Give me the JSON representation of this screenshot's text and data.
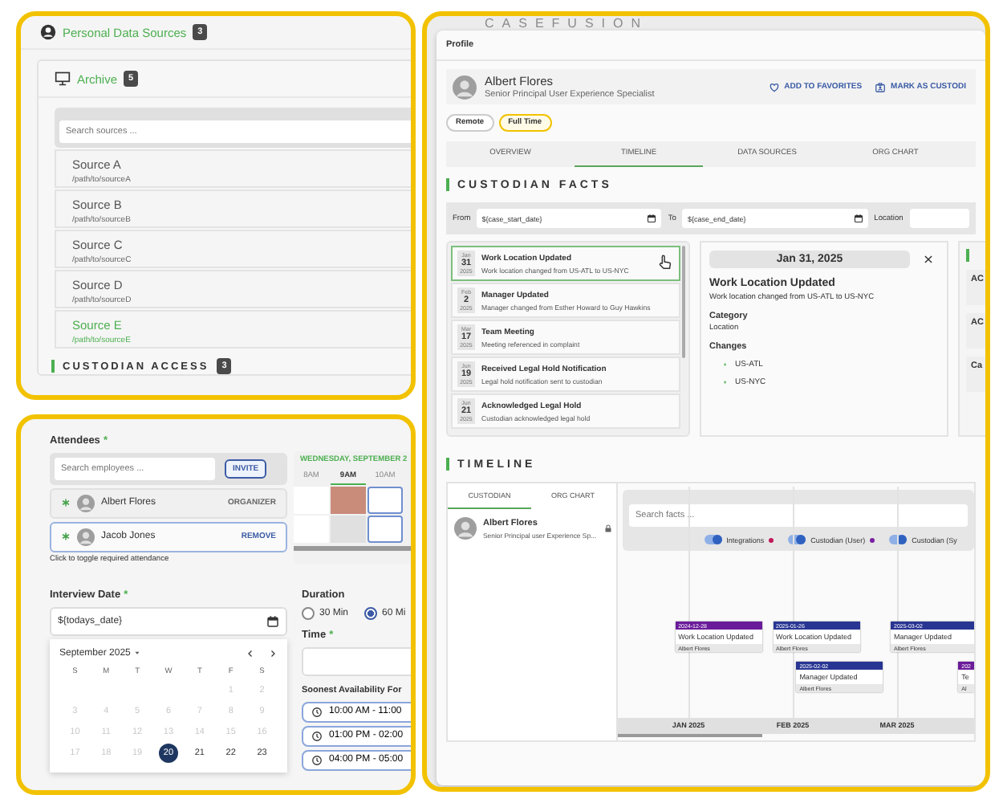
{
  "panel_sources": {
    "title": "Personal Data Sources",
    "count": "3",
    "archive": {
      "title": "Archive",
      "count": "5",
      "search_placeholder": "Search sources ...",
      "sources": [
        {
          "name": "Source A",
          "path": "/path/to/sourceA",
          "selected": false
        },
        {
          "name": "Source B",
          "path": "/path/to/sourceB",
          "selected": false
        },
        {
          "name": "Source C",
          "path": "/path/to/sourceC",
          "selected": false
        },
        {
          "name": "Source D",
          "path": "/path/to/sourceD",
          "selected": false
        },
        {
          "name": "Source E",
          "path": "/path/to/sourceE",
          "selected": true
        }
      ]
    },
    "custodian_access": {
      "title": "CUSTODIAN ACCESS",
      "count": "3"
    }
  },
  "panel_meeting": {
    "attendees": {
      "label": "Attendees",
      "required_mark": "*",
      "search_placeholder": "Search employees ...",
      "invite": "INVITE",
      "people": [
        {
          "name": "Albert Flores",
          "action": "ORGANIZER",
          "required": true,
          "selected": false
        },
        {
          "name": "Jacob Jones",
          "action": "REMOVE",
          "required": true,
          "selected": true
        }
      ],
      "hint": "Click to toggle required attendance"
    },
    "schedule": {
      "day": "WEDNESDAY, SEPTEMBER 2",
      "hours": [
        {
          "label": "8AM",
          "selected": false
        },
        {
          "label": "9AM",
          "selected": true
        },
        {
          "label": "10AM",
          "selected": false
        }
      ],
      "rows": [
        {
          "cells": [
            {
              "kind": "open"
            },
            {
              "kind": "busy"
            },
            {
              "kind": "slot"
            }
          ]
        },
        {
          "cells": [
            {
              "kind": "open"
            },
            {
              "kind": "blocked"
            },
            {
              "kind": "slot"
            }
          ]
        }
      ]
    },
    "interview_date": {
      "label": "Interview Date",
      "required_mark": "*",
      "value": "${todays_date}",
      "calendar": {
        "month": "September 2025",
        "weekdays": [
          "S",
          "M",
          "T",
          "W",
          "T",
          "F",
          "S"
        ],
        "weeks": [
          {
            "days": [
              {
                "label": "1",
                "disabled": true,
                "selected": false
              },
              {
                "label": "2",
                "disabled": true,
                "selected": false
              }
            ]
          },
          {
            "days": [
              {
                "label": "3",
                "disabled": true,
                "selected": false
              },
              {
                "label": "4",
                "disabled": true,
                "selected": false
              },
              {
                "label": "5",
                "disabled": true,
                "selected": false
              },
              {
                "label": "6",
                "disabled": true,
                "selected": false
              },
              {
                "label": "7",
                "disabled": true,
                "selected": false
              },
              {
                "label": "8",
                "disabled": true,
                "selected": false
              },
              {
                "label": "9",
                "disabled": true,
                "selected": false
              }
            ]
          },
          {
            "days": [
              {
                "label": "10",
                "disabled": true,
                "selected": false
              },
              {
                "label": "11",
                "disabled": true,
                "selected": false
              },
              {
                "label": "12",
                "disabled": true,
                "selected": false
              },
              {
                "label": "13",
                "disabled": true,
                "selected": false
              },
              {
                "label": "14",
                "disabled": true,
                "selected": false
              },
              {
                "label": "15",
                "disabled": true,
                "selected": false
              },
              {
                "label": "16",
                "disabled": true,
                "selected": false
              }
            ]
          },
          {
            "days": [
              {
                "label": "17",
                "disabled": true,
                "selected": false
              },
              {
                "label": "18",
                "disabled": true,
                "selected": false
              },
              {
                "label": "19",
                "disabled": true,
                "selected": false
              },
              {
                "label": "20",
                "disabled": false,
                "selected": true
              },
              {
                "label": "21",
                "disabled": false,
                "selected": false
              },
              {
                "label": "22",
                "disabled": false,
                "selected": false
              },
              {
                "label": "23",
                "disabled": false,
                "selected": false
              }
            ]
          }
        ]
      }
    },
    "duration": {
      "label": "Duration",
      "options": [
        {
          "label": "30 Min",
          "selected": false
        },
        {
          "label": "60 Mi",
          "selected": true
        }
      ]
    },
    "time": {
      "label": "Time",
      "required_mark": "*"
    },
    "availability": {
      "label": "Soonest Availability For",
      "slots": [
        "10:00 AM - 11:00",
        "01:00 PM - 02:00",
        "04:00 PM - 05:00"
      ]
    }
  },
  "panel_profile": {
    "logo": "CASEFUSION",
    "header": "Profile",
    "person": {
      "name": "Albert Flores",
      "title": "Senior Principal User Experience Specialist"
    },
    "actions": [
      {
        "label": "ADD TO FAVORITES",
        "kind": "favorite"
      },
      {
        "label": "MARK AS CUSTODI",
        "kind": "custodian"
      }
    ],
    "tags": [
      {
        "label": "Remote",
        "highlighted": false
      },
      {
        "label": "Full Time",
        "highlighted": true
      }
    ],
    "tabs": [
      {
        "label": "OVERVIEW",
        "selected": false
      },
      {
        "label": "TIMELINE",
        "selected": true
      },
      {
        "label": "DATA SOURCES",
        "selected": false
      },
      {
        "label": "ORG CHART",
        "selected": false
      }
    ],
    "facts": {
      "title": "CUSTODIAN FACTS",
      "filters": [
        {
          "label": "From",
          "value": "${case_start_date}",
          "kind": "date"
        },
        {
          "label": "To",
          "value": "${case_end_date}",
          "kind": "date"
        },
        {
          "label": "Location",
          "kind": "text"
        }
      ],
      "items": [
        {
          "month": "Jan",
          "day": "31",
          "year": "2025",
          "title": "Work Location Updated",
          "description": "Work location changed from US-ATL to US-NYC",
          "selected": true
        },
        {
          "month": "Feb",
          "day": "2",
          "year": "2025",
          "title": "Manager Updated",
          "description": "Manager changed from Esther Howard to Guy Hawkins",
          "selected": false
        },
        {
          "month": "Mar",
          "day": "17",
          "year": "2025",
          "title": "Team Meeting",
          "description": "Meeting referenced in complaint",
          "selected": false
        },
        {
          "month": "Jun",
          "day": "19",
          "year": "2025",
          "title": "Received Legal Hold Notification",
          "description": "Legal hold notification sent to custodian",
          "selected": false
        },
        {
          "month": "Jun",
          "day": "21",
          "year": "2025",
          "title": "Acknowledged Legal Hold",
          "description": "Custodian acknowledged legal hold",
          "selected": false
        }
      ],
      "detail": {
        "date": "Jan 31, 2025",
        "title": "Work Location Updated",
        "description": "Work location changed from US-ATL to US-NYC",
        "category_label": "Category",
        "category": "Location",
        "changes_label": "Changes",
        "changes": [
          "US-ATL",
          "US-NYC"
        ]
      },
      "side_cards": [
        {
          "title": "AC"
        },
        {
          "title": "AC"
        },
        {
          "title": "Ca"
        }
      ]
    },
    "timeline": {
      "title": "TIMELINE",
      "tabs": [
        {
          "label": "CUSTODIAN",
          "selected": true
        },
        {
          "label": "ORG CHART",
          "selected": false
        }
      ],
      "person": {
        "name": "Albert Flores",
        "title": "Senior Principal user Experience Sp..."
      },
      "search_placeholder": "Search facts ...",
      "toggles": [
        {
          "label": "Integrations",
          "on": true,
          "color": "#c2185b"
        },
        {
          "label": "Custodian (User)",
          "on": true,
          "color": "#7b1fa2"
        },
        {
          "label": "Custodian (Sy",
          "on": true
        }
      ],
      "events": [
        {
          "date": "2024-12-28",
          "title": "Work Location Updated",
          "person": "Albert Flores",
          "color": "#6a1b9a"
        },
        {
          "date": "2025-01-26",
          "title": "Work Location Updated",
          "person": "Albert Flores",
          "color": "#283593"
        },
        {
          "date": "2025-02-02",
          "title": "Manager Updated",
          "person": "Albert Flores",
          "color": "#283593"
        },
        {
          "date": "2025-03-02",
          "title": "Manager Updated",
          "person": "Albert Flores",
          "color": "#283593"
        },
        {
          "date": "202",
          "title": "Te",
          "person": "Al",
          "color": "#6a1b9a"
        }
      ],
      "months": [
        "JAN 2025",
        "FEB 2025",
        "MAR 2025"
      ]
    }
  }
}
